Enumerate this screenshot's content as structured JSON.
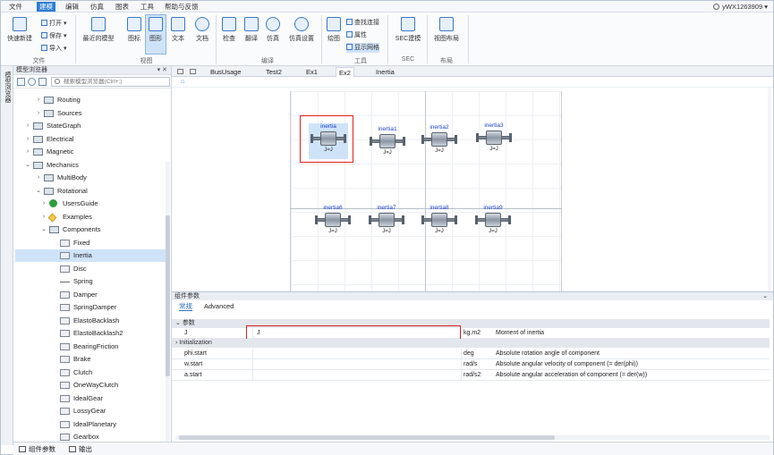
{
  "menubar": {
    "items": [
      "文件",
      "建模",
      "编辑",
      "仿真",
      "图表",
      "工具",
      "帮助与反馈"
    ],
    "active_index": 1,
    "user": "yWX1263909",
    "user_arrow": "▾"
  },
  "ribbon": {
    "quick_new": "快速新建",
    "open": "打开",
    "save": "保存",
    "import": "导入",
    "recent_models": "最近的模型",
    "icon_view": "图标",
    "diagram_view": "图形",
    "text_view": "文本",
    "doc_view": "文档",
    "check": "检查",
    "translate": "翻译",
    "simulate": "仿真",
    "sim_settings": "仿真设置",
    "draw": "绘图",
    "find_connection": "查找连接",
    "properties": "属性",
    "show_grid": "显示网格",
    "sec_modeling": "SEC建模",
    "view_layout": "视图布局",
    "groups": {
      "file": "文件",
      "view": "视图",
      "compile": "编译",
      "tools": "工具",
      "sec": "SEC",
      "layout": "布局"
    }
  },
  "sidebar": {
    "vertical_tab": "模型浏览器",
    "title": "模型浏览器",
    "title_controls": "▾ ✕",
    "search_placeholder": "搜索模型浏览器(Ctrl+;)",
    "items": [
      {
        "label": "Routing",
        "arrow": "›",
        "icon": "pkg"
      },
      {
        "label": "Sources",
        "arrow": "›",
        "icon": "pkg"
      },
      {
        "label": "StateGraph",
        "arrow": "›",
        "icon": "pkg"
      },
      {
        "label": "Electrical",
        "arrow": "›",
        "icon": "pkg"
      },
      {
        "label": "Magnetic",
        "arrow": "›",
        "icon": "pkg"
      },
      {
        "label": "Mechanics",
        "arrow": "⌄",
        "icon": "pkg"
      },
      {
        "label": "MultiBody",
        "arrow": "›",
        "icon": "pkg"
      },
      {
        "label": "Rotational",
        "arrow": "⌄",
        "icon": "pkg"
      },
      {
        "label": "UsersGuide",
        "arrow": "›",
        "icon": "info"
      },
      {
        "label": "Examples",
        "arrow": "›",
        "icon": "ex"
      },
      {
        "label": "Components",
        "arrow": "⌄",
        "icon": "pkg"
      },
      {
        "label": "Fixed",
        "arrow": "",
        "icon": "comp"
      },
      {
        "label": "Inertia",
        "arrow": "",
        "icon": "comp"
      },
      {
        "label": "Disc",
        "arrow": "",
        "icon": "comp"
      },
      {
        "label": "Spring",
        "arrow": "",
        "icon": "line"
      },
      {
        "label": "Damper",
        "arrow": "",
        "icon": "comp"
      },
      {
        "label": "SpringDamper",
        "arrow": "",
        "icon": "comp"
      },
      {
        "label": "ElastoBacklash",
        "arrow": "",
        "icon": "comp"
      },
      {
        "label": "ElastoBacklash2",
        "arrow": "",
        "icon": "comp"
      },
      {
        "label": "BearingFriction",
        "arrow": "",
        "icon": "comp"
      },
      {
        "label": "Brake",
        "arrow": "",
        "icon": "comp"
      },
      {
        "label": "Clutch",
        "arrow": "",
        "icon": "comp"
      },
      {
        "label": "OneWayClutch",
        "arrow": "",
        "icon": "comp"
      },
      {
        "label": "IdealGear",
        "arrow": "",
        "icon": "comp"
      },
      {
        "label": "LossyGear",
        "arrow": "",
        "icon": "comp"
      },
      {
        "label": "IdealPlanetary",
        "arrow": "",
        "icon": "comp"
      },
      {
        "label": "Gearbox",
        "arrow": "",
        "icon": "comp"
      }
    ],
    "selected_index": 12
  },
  "bottom_tabs": [
    "组件参数",
    "输出"
  ],
  "doc_tabs": {
    "items": [
      "BusUsage",
      "Test2",
      "Ex1",
      "Ex2",
      "Inertia"
    ],
    "active_index": 3
  },
  "breadcrumb_home": "⌂",
  "diagram": {
    "components": [
      {
        "name": "inertia",
        "param": "J=J",
        "selected": true
      },
      {
        "name": "inertia1",
        "param": "J=J",
        "selected": false
      },
      {
        "name": "inertia2",
        "param": "J=J",
        "selected": false
      },
      {
        "name": "inertia3",
        "param": "J=J",
        "selected": false
      },
      {
        "name": "inertia6",
        "param": "J=J",
        "selected": false
      },
      {
        "name": "inertia7",
        "param": "J=J",
        "selected": false
      },
      {
        "name": "inertia8",
        "param": "J=J",
        "selected": false
      },
      {
        "name": "inertia9",
        "param": "J=J",
        "selected": false
      }
    ],
    "highlight_color": "#e02020"
  },
  "params_panel": {
    "title": "组件参数",
    "tabs": [
      "常规",
      "Advanced"
    ],
    "active_tab": 0,
    "sections": [
      "参数",
      "Initialization"
    ],
    "rows": [
      {
        "name": "J",
        "value": "J",
        "unit": "kg.m2",
        "desc": "Moment of inertia"
      },
      {
        "name": "phi.start",
        "value": "",
        "unit": "deg",
        "desc": "Absolute rotation angle of component"
      },
      {
        "name": "w.start",
        "value": "",
        "unit": "rad/s",
        "desc": "Absolute angular velocity of component (= der(phi))"
      },
      {
        "name": "a.start",
        "value": "",
        "unit": "rad/s2",
        "desc": "Absolute angular acceleration of component (= der(w))"
      }
    ]
  }
}
